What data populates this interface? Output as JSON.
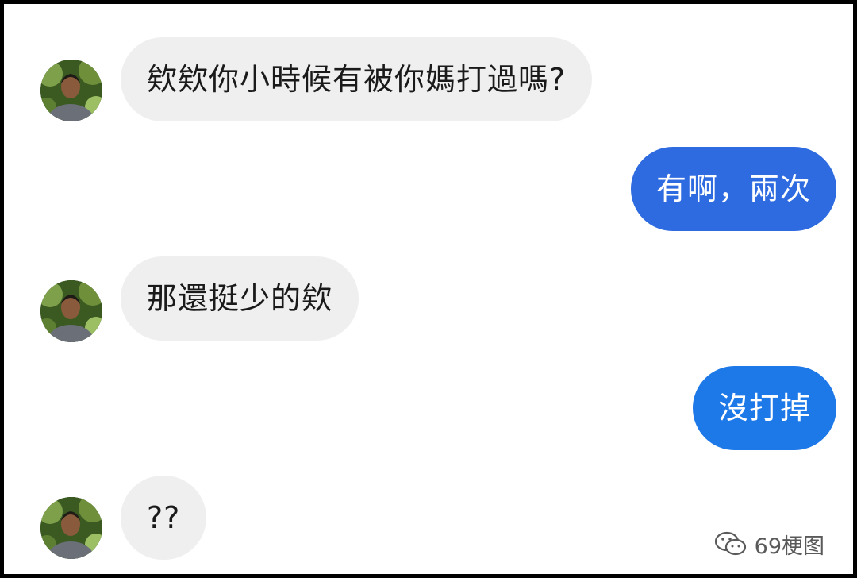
{
  "messages": [
    {
      "side": "incoming",
      "text": "欸欸你小時候有被你媽打過嗎?",
      "avatar_icon": "user-avatar"
    },
    {
      "side": "outgoing",
      "text": "有啊，兩次"
    },
    {
      "side": "incoming",
      "text": "那還挺少的欸",
      "avatar_icon": "user-avatar"
    },
    {
      "side": "outgoing",
      "text": "沒打掉"
    },
    {
      "side": "incoming",
      "text": "??",
      "avatar_icon": "user-avatar"
    }
  ],
  "watermark": {
    "icon": "wechat-icon",
    "label": "69梗图"
  },
  "colors": {
    "incoming_bubble": "#efefef",
    "outgoing_bubble_1": "#2f6be0",
    "outgoing_bubble_2": "#1d78e8",
    "border": "#000000"
  }
}
